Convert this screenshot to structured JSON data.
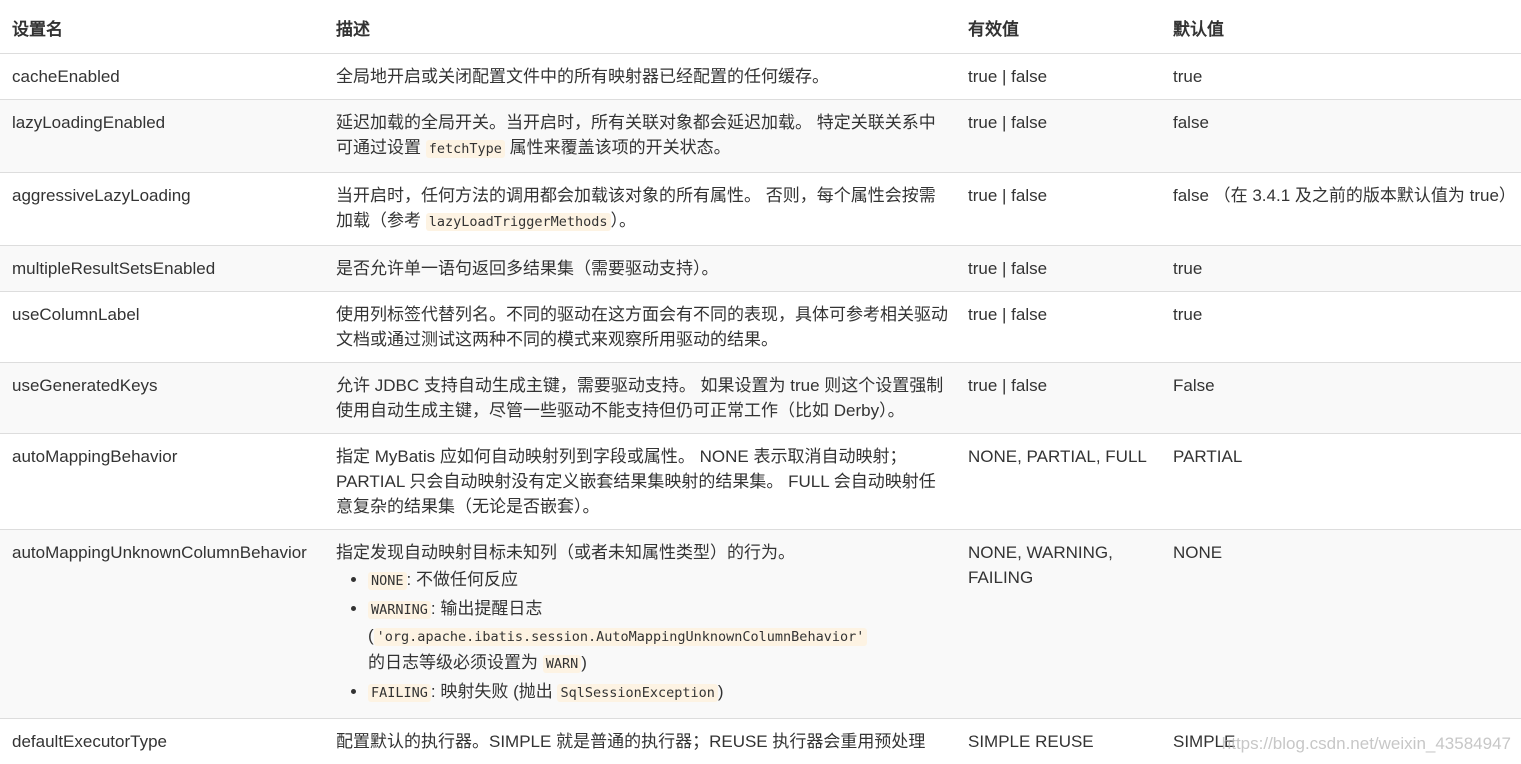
{
  "header": {
    "name": "设置名",
    "desc": "描述",
    "valid": "有效值",
    "default": "默认值"
  },
  "rows": [
    {
      "name": "cacheEnabled",
      "desc": "全局地开启或关闭配置文件中的所有映射器已经配置的任何缓存。",
      "valid": "true | false",
      "default": "true"
    },
    {
      "name": "lazyLoadingEnabled",
      "desc_a": "延迟加载的全局开关。当开启时，所有关联对象都会延迟加载。 特定关联关系中可通过设置 ",
      "desc_code": "fetchType",
      "desc_b": " 属性来覆盖该项的开关状态。",
      "valid": "true | false",
      "default": "false"
    },
    {
      "name": "aggressiveLazyLoading",
      "desc_a": "当开启时，任何方法的调用都会加载该对象的所有属性。 否则，每个属性会按需加载（参考 ",
      "desc_code": "lazyLoadTriggerMethods",
      "desc_b": "）。",
      "valid": "true | false",
      "default": "false （在 3.4.1 及之前的版本默认值为 true）"
    },
    {
      "name": "multipleResultSetsEnabled",
      "desc": "是否允许单一语句返回多结果集（需要驱动支持）。",
      "valid": "true | false",
      "default": "true"
    },
    {
      "name": "useColumnLabel",
      "desc": "使用列标签代替列名。不同的驱动在这方面会有不同的表现，具体可参考相关驱动文档或通过测试这两种不同的模式来观察所用驱动的结果。",
      "valid": "true | false",
      "default": "true"
    },
    {
      "name": "useGeneratedKeys",
      "desc": "允许 JDBC 支持自动生成主键，需要驱动支持。 如果设置为 true 则这个设置强制使用自动生成主键，尽管一些驱动不能支持但仍可正常工作（比如 Derby）。",
      "valid": "true | false",
      "default": "False"
    },
    {
      "name": "autoMappingBehavior",
      "desc_l1": "指定 MyBatis 应如何自动映射列到字段或属性。 NONE 表示取消自动映射；",
      "desc_l2": "PARTIAL 只会自动映射没有定义嵌套结果集映射的结果集。 FULL 会自动映射任意复杂的结果集（无论是否嵌套）。",
      "valid": "NONE, PARTIAL, FULL",
      "default": "PARTIAL"
    },
    {
      "name": "autoMappingUnknownColumnBehavior",
      "desc": "指定发现自动映射目标未知列（或者未知属性类型）的行为。",
      "items": [
        {
          "code": "NONE",
          "text": ": 不做任何反应"
        },
        {
          "code": "WARNING",
          "text": ": 输出提醒日志",
          "paren_open": "(",
          "code2": "'org.apache.ibatis.session.AutoMappingUnknownColumnBehavior'",
          "text2": "的日志等级必须设置为 ",
          "code3": "WARN",
          "paren_close": ")"
        },
        {
          "code": "FAILING",
          "text": ": 映射失败 (抛出 ",
          "code2": "SqlSessionException",
          "paren_close": ")"
        }
      ],
      "valid": "NONE, WARNING, FAILING",
      "default": "NONE"
    },
    {
      "name": "defaultExecutorType",
      "desc": "配置默认的执行器。SIMPLE 就是普通的执行器；REUSE 执行器会重用预处理",
      "valid": "SIMPLE REUSE",
      "default": "SIMPLE"
    }
  ],
  "watermark": "https://blog.csdn.net/weixin_43584947"
}
